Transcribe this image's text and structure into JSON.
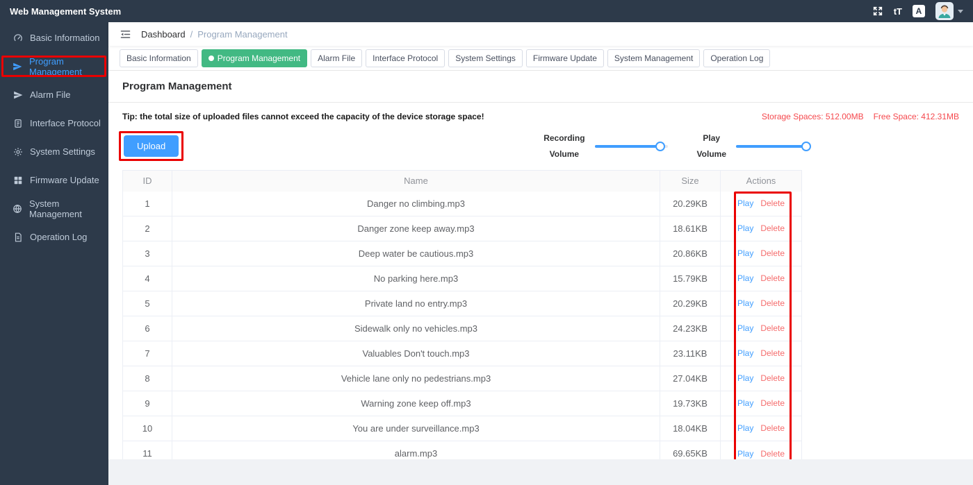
{
  "app": {
    "title": "Web Management System"
  },
  "topbar": {
    "font_size_icon_label": "tT",
    "language_icon_label": "A"
  },
  "sidebar": {
    "items": [
      {
        "label": "Basic Information",
        "icon": "gauge-icon",
        "active": false,
        "annotated": false
      },
      {
        "label": "Program Management",
        "icon": "paper-plane-icon",
        "active": true,
        "annotated": true
      },
      {
        "label": "Alarm File",
        "icon": "paper-plane-icon",
        "active": false,
        "annotated": false
      },
      {
        "label": "Interface Protocol",
        "icon": "document-icon",
        "active": false,
        "annotated": false
      },
      {
        "label": "System Settings",
        "icon": "gear-icon",
        "active": false,
        "annotated": false
      },
      {
        "label": "Firmware Update",
        "icon": "grid-icon",
        "active": false,
        "annotated": false
      },
      {
        "label": "System Management",
        "icon": "globe-icon",
        "active": false,
        "annotated": false
      },
      {
        "label": "Operation Log",
        "icon": "file-text-icon",
        "active": false,
        "annotated": false
      }
    ]
  },
  "breadcrumb": {
    "root": "Dashboard",
    "separator": "/",
    "current": "Program Management"
  },
  "tabs": [
    {
      "label": "Basic Information",
      "active": false
    },
    {
      "label": "Program Management",
      "active": true
    },
    {
      "label": "Alarm File",
      "active": false
    },
    {
      "label": "Interface Protocol",
      "active": false
    },
    {
      "label": "System Settings",
      "active": false
    },
    {
      "label": "Firmware Update",
      "active": false
    },
    {
      "label": "System Management",
      "active": false
    },
    {
      "label": "Operation Log",
      "active": false
    }
  ],
  "content": {
    "title": "Program Management",
    "tip": "Tip: the total size of uploaded files cannot exceed the capacity of the device storage space!",
    "storage_spaces": "Storage Spaces: 512.00MB",
    "free_space": "Free Space: 412.31MB",
    "upload_label": "Upload",
    "sliders": [
      {
        "line1": "Recording",
        "line2": "Volume",
        "percent": 90
      },
      {
        "line1": "Play",
        "line2": "Volume",
        "percent": 96
      }
    ],
    "table": {
      "headers": [
        "ID",
        "Name",
        "Size",
        "Actions"
      ],
      "actions": {
        "play": "Play",
        "delete": "Delete"
      },
      "rows": [
        {
          "id": "1",
          "name": "Danger no climbing.mp3",
          "size": "20.29KB"
        },
        {
          "id": "2",
          "name": "Danger zone keep away.mp3",
          "size": "18.61KB"
        },
        {
          "id": "3",
          "name": "Deep water be cautious.mp3",
          "size": "20.86KB"
        },
        {
          "id": "4",
          "name": "No parking here.mp3",
          "size": "15.79KB"
        },
        {
          "id": "5",
          "name": "Private land no entry.mp3",
          "size": "20.29KB"
        },
        {
          "id": "6",
          "name": "Sidewalk only no vehicles.mp3",
          "size": "24.23KB"
        },
        {
          "id": "7",
          "name": "Valuables Don't touch.mp3",
          "size": "23.11KB"
        },
        {
          "id": "8",
          "name": "Vehicle lane only no pedestrians.mp3",
          "size": "27.04KB"
        },
        {
          "id": "9",
          "name": "Warning zone keep off.mp3",
          "size": "19.73KB"
        },
        {
          "id": "10",
          "name": "You are under surveillance.mp3",
          "size": "18.04KB"
        },
        {
          "id": "11",
          "name": "alarm.mp3",
          "size": "69.65KB"
        }
      ]
    }
  },
  "colors": {
    "accent_blue": "#409EFF",
    "active_tab_green": "#42b983",
    "danger_red": "#f56c6c",
    "storage_red": "#f5484d",
    "annotation_red": "#ea0000",
    "sidebar_dark": "#2d3a4a"
  }
}
